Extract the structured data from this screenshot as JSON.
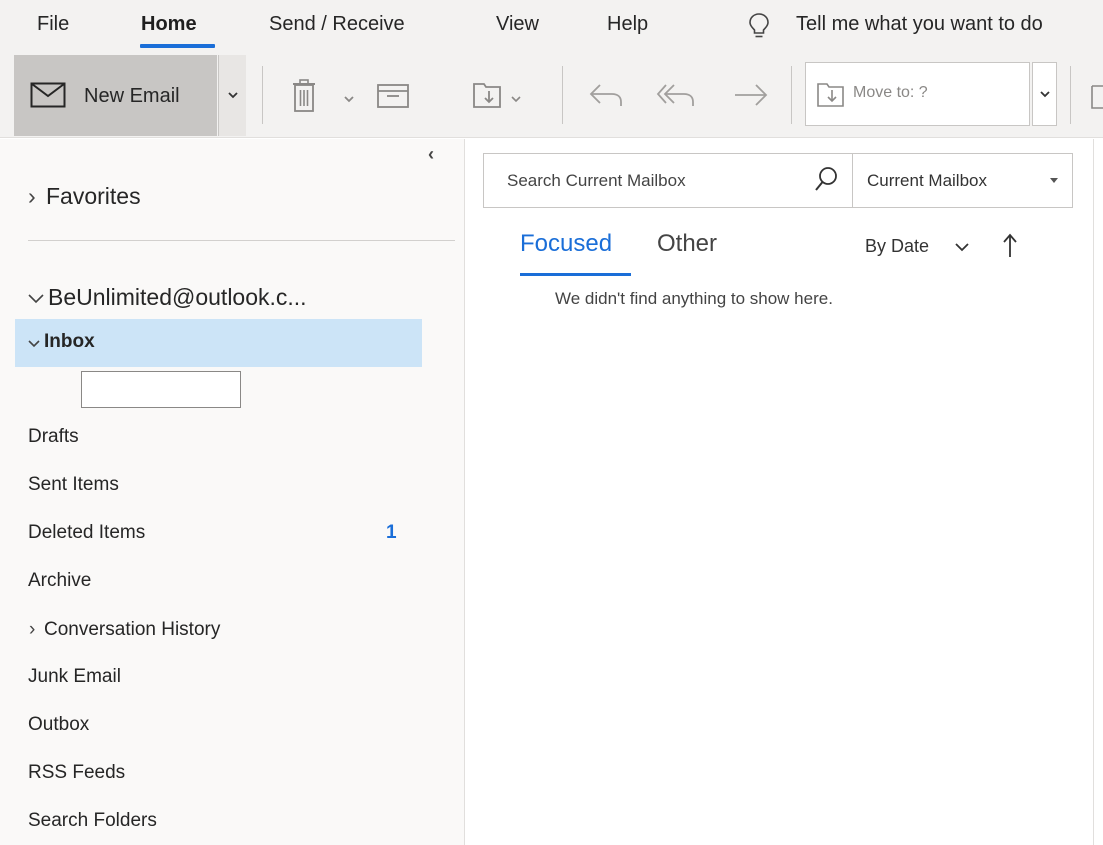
{
  "menu": {
    "items": [
      "File",
      "Home",
      "Send / Receive",
      "View",
      "Help"
    ],
    "active": "Home",
    "tell_me": "Tell me what you want to do"
  },
  "ribbon": {
    "new_email_label": "New Email",
    "move_to_label": "Move to: ?"
  },
  "folders": {
    "favorites_label": "Favorites",
    "account_label": "BeUnlimited@outlook.c...",
    "inbox_label": "Inbox",
    "rename_value": "",
    "items": [
      {
        "label": "Drafts",
        "count": ""
      },
      {
        "label": "Sent Items",
        "count": ""
      },
      {
        "label": "Deleted Items",
        "count": "1"
      },
      {
        "label": "Archive",
        "count": ""
      },
      {
        "label": "Conversation History",
        "count": "",
        "expandable": true
      },
      {
        "label": "Junk Email",
        "count": ""
      },
      {
        "label": "Outbox",
        "count": ""
      },
      {
        "label": "RSS Feeds",
        "count": ""
      },
      {
        "label": "Search Folders",
        "count": ""
      }
    ]
  },
  "message_list": {
    "search_placeholder": "Search Current Mailbox",
    "scope_label": "Current Mailbox",
    "tabs": {
      "focused": "Focused",
      "other": "Other"
    },
    "sort_label": "By Date",
    "empty_message": "We didn't find anything to show here."
  },
  "colors": {
    "accent": "#1a6ed8",
    "selected_folder": "#cce4f7",
    "chrome": "#f3f2f1"
  }
}
